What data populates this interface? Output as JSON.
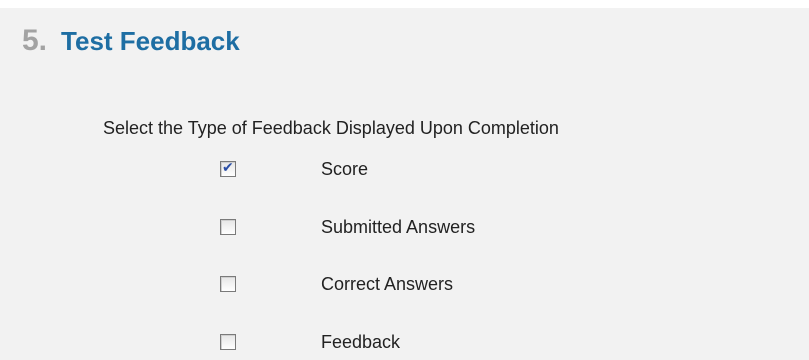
{
  "section": {
    "number": "5.",
    "title": "Test Feedback"
  },
  "prompt": "Select the Type of Feedback Displayed Upon Completion",
  "options": [
    {
      "label": "Score",
      "checked": true
    },
    {
      "label": "Submitted Answers",
      "checked": false
    },
    {
      "label": "Correct Answers",
      "checked": false
    },
    {
      "label": "Feedback",
      "checked": false
    }
  ],
  "colors": {
    "title": "#1e6ea3",
    "step_number": "#a3a3a3",
    "background": "#f2f2f2"
  },
  "icons": {
    "checked": "checkmark-icon"
  }
}
